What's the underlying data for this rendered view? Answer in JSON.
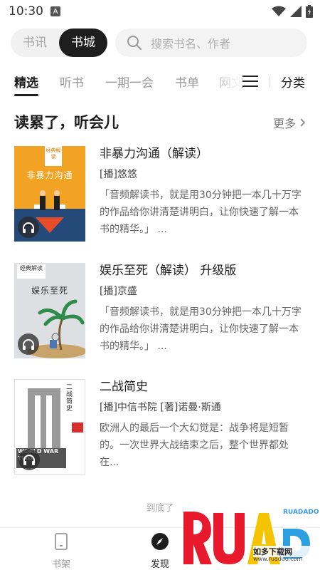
{
  "status": {
    "time": "10:30",
    "a_badge": "A"
  },
  "top": {
    "segments": [
      "书讯",
      "书城"
    ],
    "active_segment": 1,
    "search_placeholder": "搜索书名、作者"
  },
  "tabs": {
    "items": [
      "精选",
      "听书",
      "一期一会",
      "书单",
      "网文"
    ],
    "category": "分类"
  },
  "section": {
    "title": "读累了，听会儿",
    "more": "更多"
  },
  "books": [
    {
      "title": "非暴力沟通（解读）",
      "author": "[播]悠悠",
      "desc": "「音频解读书，就是用30分钟把一本几十万字的作品给你讲清楚讲明白，让你快速了解一本书的精华。」 ...",
      "cover_label": "经典解读",
      "cover_title": "非暴力沟通",
      "cover_color": "#f2a324"
    },
    {
      "title": "娱乐至死（解读） 升级版",
      "author": "[播]京盛",
      "desc": "「音频解读书，就是用30分钟把一本几十万字的作品给你讲清楚讲明白，让你快速了解一本书的精华。」 ...",
      "cover_label": "经典解读",
      "cover_title": "娱乐至死",
      "cover_color": "#dedfe2"
    },
    {
      "title": "二战简史",
      "author": "[播]中信书院 [著]诺曼·斯通",
      "desc": "欧洲人的最后一个大幻觉是：战争将是短暂的。一次世界大战结束之后，整个世界都处在...",
      "cover_label": "二战简史",
      "cover_title": "WORLD WAR TWO",
      "cover_color": "#ffffff"
    }
  ],
  "end_text": "到底了",
  "nav": {
    "shelf": "书架",
    "discover": "发现"
  },
  "watermark": {
    "logo": "RUADADO",
    "sub": "如多下载网",
    "url": "www.ruaduo.com"
  }
}
